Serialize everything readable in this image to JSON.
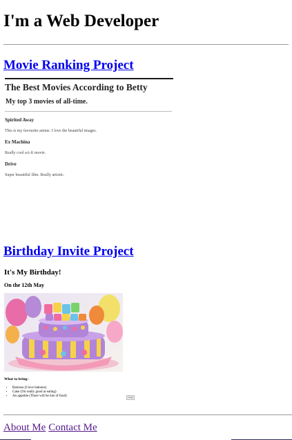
{
  "header": {
    "title": "I'm a Web Developer"
  },
  "projects": [
    {
      "link_label": "Movie Ranking Project"
    },
    {
      "link_label": "Birthday Invite Project"
    }
  ],
  "movie_preview": {
    "title": "The Best Movies According to Betty",
    "subtitle": "My top 3 movies of all-time.",
    "movies": [
      {
        "title": "Spirited Away",
        "text": "This is my favourite anime. I love the beautiful images."
      },
      {
        "title": "Ex Machina",
        "text": "Really cool sci-fi movie."
      },
      {
        "title": "Drive",
        "text": "Super beautiful film. Really artistic."
      }
    ]
  },
  "birthday_preview": {
    "title": "It's My Birthday!",
    "date": "On the 12th May",
    "bring_heading": "What to bring:",
    "items": [
      "Baloons (I love baloons)",
      "Cake (I'm really good at eating)",
      "An appetite (There will be lots of food)"
    ],
    "button_label": "Goog"
  },
  "footer": {
    "about_label": "About Me",
    "contact_label": "Contact Me"
  }
}
